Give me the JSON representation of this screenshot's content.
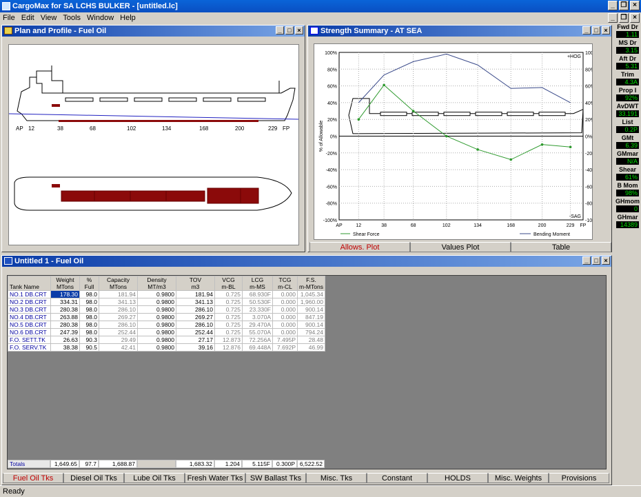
{
  "window": {
    "title": "CargoMax for SA LCHS BULKER - [untitled.lc]"
  },
  "menu": [
    "File",
    "Edit",
    "View",
    "Tools",
    "Window",
    "Help"
  ],
  "plan_profile": {
    "title": "Plan and Profile - Fuel Oil",
    "frames": [
      "AP",
      "12",
      "38",
      "68",
      "102",
      "134",
      "168",
      "200",
      "229",
      "FP"
    ]
  },
  "strength": {
    "title": "Strength Summary - AT SEA",
    "tabs": [
      "Allows. Plot",
      "Values Plot",
      "Table"
    ]
  },
  "chart_data": {
    "type": "line",
    "x_labels": [
      "AP",
      "12",
      "38",
      "68",
      "102",
      "134",
      "168",
      "200",
      "229",
      "FP"
    ],
    "ylabel": "% of Allowable",
    "ylim": [
      -100,
      100
    ],
    "y_ticks": [
      "100%",
      "80%",
      "60%",
      "40%",
      "20%",
      "0%",
      "-20%",
      "-40%",
      "-60%",
      "-80%",
      "-100%"
    ],
    "annotations": [
      "+HOG",
      "-SAG"
    ],
    "series": [
      {
        "name": "Shear Force",
        "color": "#2e9a2e",
        "x_frames": [
          12,
          38,
          68,
          102,
          134,
          168,
          200,
          229
        ],
        "values": [
          20,
          61,
          30,
          0,
          -16,
          -28,
          -10,
          -13
        ]
      },
      {
        "name": "Bending Moment",
        "color": "#3a4a8a",
        "x_frames": [
          12,
          38,
          68,
          102,
          134,
          168,
          200,
          229
        ],
        "values": [
          40,
          73,
          89,
          98,
          85,
          57,
          58,
          40
        ]
      }
    ]
  },
  "readouts": [
    {
      "label": "Fwd Dr",
      "value": "1.11"
    },
    {
      "label": "MS Dr",
      "value": "3.15"
    },
    {
      "label": "Aft Dr",
      "value": "5.31"
    },
    {
      "label": "Trim",
      "value": "4.3A"
    },
    {
      "label": "Prop I",
      "value": "92%"
    },
    {
      "label": "AvDWT",
      "value": "33.191"
    },
    {
      "label": "List",
      "value": "0.2P"
    },
    {
      "label": "GMt",
      "value": "6.39"
    },
    {
      "label": "GMmar",
      "value": "N/A"
    },
    {
      "label": "Shear",
      "value": "61%"
    },
    {
      "label": "B Mom",
      "value": "98%"
    },
    {
      "label": "GHmom",
      "value": "0"
    },
    {
      "label": "GHmar",
      "value": "14389"
    }
  ],
  "tanks": {
    "title": "Untitled 1 - Fuel Oil",
    "headers": [
      [
        "Tank Name",
        ""
      ],
      [
        "Weight",
        "MTons"
      ],
      [
        "%",
        "Full"
      ],
      [
        "Capacity",
        "MTons"
      ],
      [
        "Density",
        "MT/m3"
      ],
      [
        "TOV",
        "m3"
      ],
      [
        "VCG",
        "m-BL"
      ],
      [
        "LCG",
        "m-MS"
      ],
      [
        "TCG",
        "m-CL"
      ],
      [
        "F.S.",
        "m-MTons"
      ]
    ],
    "rows": [
      [
        "NO.1 DB.CRT",
        "178.30",
        "98.0",
        "181.94",
        "0.9800",
        "181.94",
        "0.725",
        "68.930F",
        "0.000",
        "1,045.34"
      ],
      [
        "NO.2 DB.CRT",
        "334.31",
        "98.0",
        "341.13",
        "0.9800",
        "341.13",
        "0.725",
        "50.530F",
        "0.000",
        "1,960.00"
      ],
      [
        "NO.3 DB.CRT",
        "280.38",
        "98.0",
        "286.10",
        "0.9800",
        "286.10",
        "0.725",
        "23.330F",
        "0.000",
        "900.14"
      ],
      [
        "NO.4 DB.CRT",
        "263.88",
        "98.0",
        "269.27",
        "0.9800",
        "269.27",
        "0.725",
        "3.070A",
        "0.000",
        "847.19"
      ],
      [
        "NO.5 DB.CRT",
        "280.38",
        "98.0",
        "286.10",
        "0.9800",
        "286.10",
        "0.725",
        "29.470A",
        "0.000",
        "900.14"
      ],
      [
        "NO.6 DB.CRT",
        "247.39",
        "98.0",
        "252.44",
        "0.9800",
        "252.44",
        "0.725",
        "55.070A",
        "0.000",
        "794.24"
      ],
      [
        "F.O. SETT.TK",
        "26.63",
        "90.3",
        "29.49",
        "0.9800",
        "27.17",
        "12.873",
        "72.256A",
        "7.495P",
        "28.48"
      ],
      [
        "F.O. SERV.TK",
        "38.38",
        "90.5",
        "42.41",
        "0.9800",
        "39.16",
        "12.876",
        "69.448A",
        "7.692P",
        "46.99"
      ]
    ],
    "totals": [
      "Totals",
      "1,649.65",
      "97.7",
      "1,688.87",
      "",
      "1,683.32",
      "1.204",
      "5.115F",
      "0.300P",
      "6,522.52"
    ]
  },
  "bottom_tabs": [
    "Fuel Oil Tks",
    "Diesel Oil Tks",
    "Lube Oil Tks",
    "Fresh Water Tks",
    "SW Ballast Tks",
    "Misc. Tks",
    "Constant",
    "HOLDS",
    "Misc. Weights",
    "Provisions"
  ],
  "status": "Ready"
}
